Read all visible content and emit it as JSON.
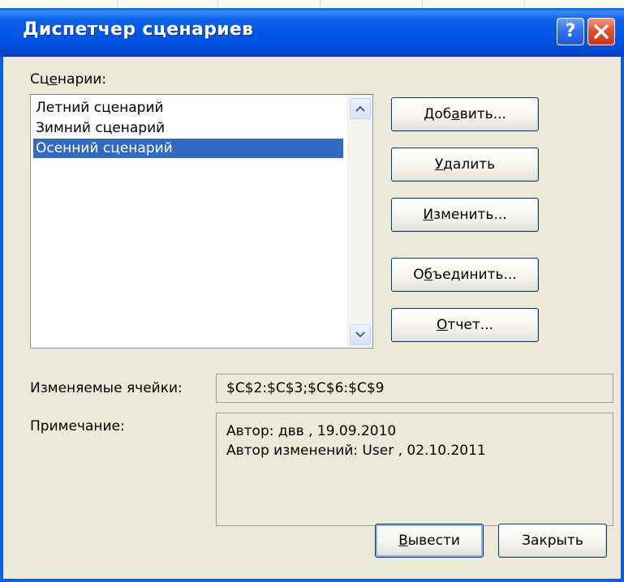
{
  "dialog": {
    "title": "Диспетчер сценариев"
  },
  "titlebar_buttons": {
    "help_label": "?",
    "help_icon": "question-icon",
    "close_icon": "close-x-icon"
  },
  "scenarios_label": {
    "pre": "Сц",
    "hotkey": "е",
    "post": "нарии:"
  },
  "scenarios": [
    {
      "label": "Летний сценарий",
      "selected": false
    },
    {
      "label": "Зимний сценарий",
      "selected": false
    },
    {
      "label": "Осенний сценарий",
      "selected": true
    }
  ],
  "buttons": {
    "add": {
      "pre": "Доб",
      "hotkey": "а",
      "post": "вить..."
    },
    "delete": {
      "pre": "",
      "hotkey": "У",
      "post": "далить"
    },
    "edit": {
      "pre": "",
      "hotkey": "И",
      "post": "зменить..."
    },
    "merge": {
      "pre": "О",
      "hotkey": "б",
      "post": "ъединить..."
    },
    "report": {
      "pre": "",
      "hotkey": "О",
      "post": "тчет..."
    },
    "show": {
      "pre": "",
      "hotkey": "В",
      "post": "ывести"
    },
    "close": {
      "pre": "",
      "hotkey": "",
      "post": "Закрыть"
    }
  },
  "changing_cells": {
    "label": "Изменяемые ячейки:",
    "value": "$C$2:$C$3;$C$6:$C$9"
  },
  "comment": {
    "label": "Примечание:",
    "lines": [
      "Автор: двв , 19.09.2010",
      "Автор изменений: User , 02.10.2011"
    ]
  },
  "colors": {
    "title_bar": "#0055e5",
    "window_body": "#ece9d8",
    "selection": "#316ac5",
    "close_button": "#e2502e"
  }
}
